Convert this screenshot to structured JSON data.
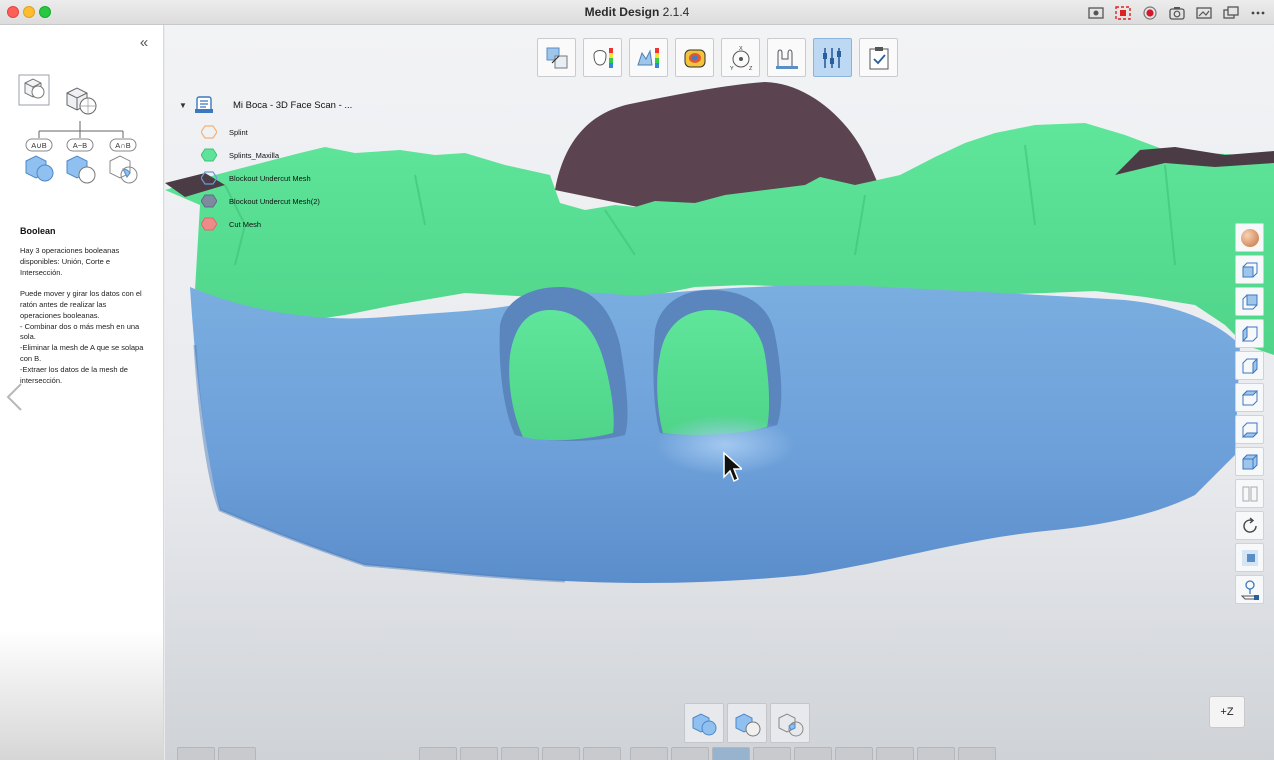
{
  "window": {
    "app_name": "Medit Design",
    "version": "2.1.4"
  },
  "left_panel": {
    "collapse_icon": "double-chevron-left-icon",
    "diagram": {
      "ops": [
        "A∪B",
        "A−B",
        "A∩B"
      ]
    },
    "help_title": "Boolean",
    "help_text": "Hay 3 operaciones booleanas disponibles: Unión, Corte e Intersección.\n\nPuede mover y girar los datos con el ratón antes de realizar las operaciones booleanas.\n- Combinar dos o más mesh en una sola.\n-Eliminar la mesh de A que se solapa con B.\n-Extraer los datos de la mesh de intersección."
  },
  "data_tree": {
    "root_label": "Mi Boca - 3D Face Scan - ...",
    "items": [
      {
        "label": "Splint",
        "color": "#f3b27a",
        "filled": false
      },
      {
        "label": "Splints_Maxilla",
        "color": "#5fe39a",
        "filled": true
      },
      {
        "label": "Blockout Undercut Mesh",
        "color": "#6a9bd8",
        "filled": false
      },
      {
        "label": "Blockout Undercut Mesh(2)",
        "color": "#7e8aa0",
        "filled": true
      },
      {
        "label": "Cut Mesh",
        "color": "#f08a8a",
        "filled": true
      }
    ]
  },
  "top_toolbar": {
    "tools": [
      {
        "name": "align-tool-icon",
        "active": false
      },
      {
        "name": "tooth-deviation-icon",
        "active": false
      },
      {
        "name": "mesh-analysis-icon",
        "active": false
      },
      {
        "name": "color-map-icon",
        "active": false
      },
      {
        "name": "axis-orientation-icon",
        "active": false
      },
      {
        "name": "measure-icon",
        "active": false
      },
      {
        "name": "mesh-tools-icon",
        "active": true
      },
      {
        "name": "checklist-icon",
        "active": false
      }
    ]
  },
  "right_toolbar": {
    "tools": [
      "material-sphere-icon",
      "view-front-icon",
      "view-back-icon",
      "view-left-icon",
      "view-right-icon",
      "view-top-icon",
      "view-bottom-icon",
      "view-iso-icon",
      "split-view-icon",
      "rotate-icon",
      "box-view-icon",
      "pin-icon"
    ]
  },
  "bool_toolbar": {
    "tools": [
      {
        "name": "union-icon",
        "active": false
      },
      {
        "name": "subtract-icon",
        "active": false
      },
      {
        "name": "intersect-icon",
        "active": false
      }
    ]
  },
  "zoom_label": "+Z",
  "colors": {
    "green_mesh": "#5fe39a",
    "blue_mesh": "#6c9fd8",
    "purple_mesh": "#5e4452",
    "active_tool": "#bcd8f2"
  }
}
